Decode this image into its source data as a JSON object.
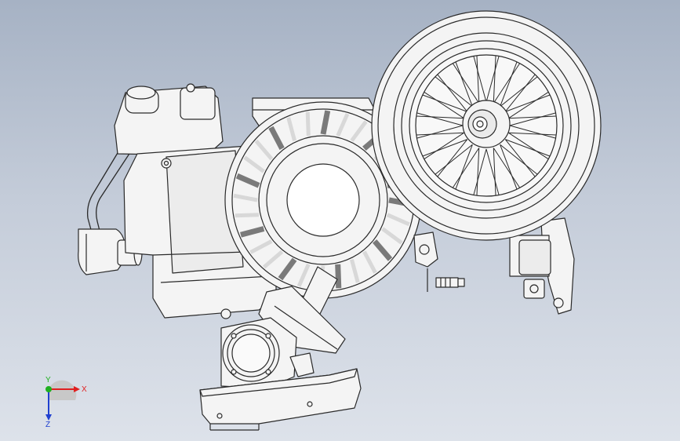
{
  "viewport": {
    "background_top": "#a6b2c4",
    "background_bottom": "#dde2ea",
    "model_outline": "#2a2a2a",
    "model_fill": "#f4f4f4"
  },
  "triad": {
    "x_label": "X",
    "y_label": "Y",
    "z_label": "Z",
    "x_color": "#e02020",
    "y_color": "#20b020",
    "z_color": "#2040d0"
  }
}
